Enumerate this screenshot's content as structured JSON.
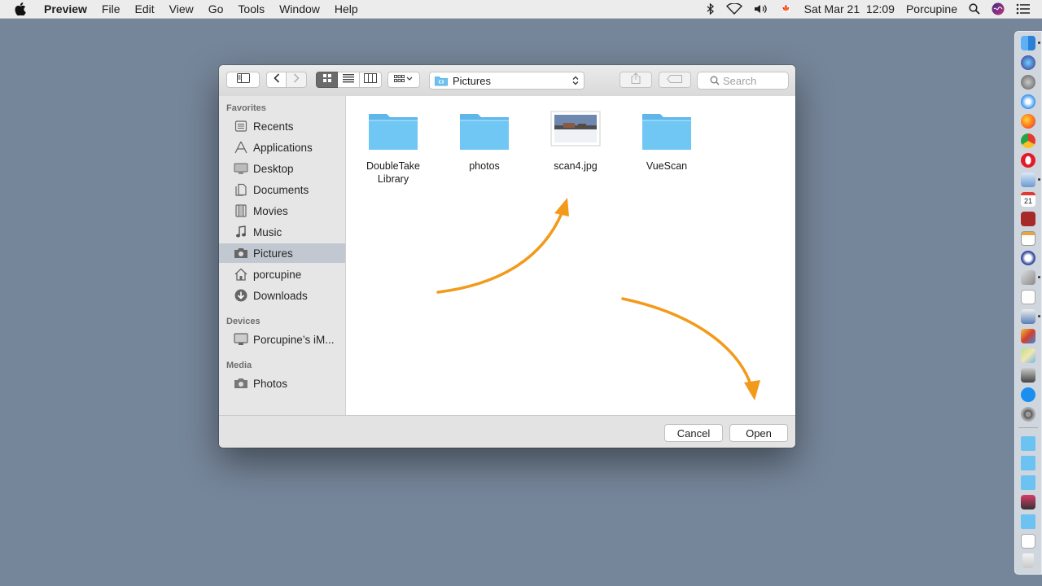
{
  "menubar": {
    "apple_icon": "apple-icon",
    "app_name": "Preview",
    "menus": [
      "File",
      "Edit",
      "View",
      "Go",
      "Tools",
      "Window",
      "Help"
    ],
    "datetime": "Sat Mar 21  12:09",
    "user": "Porcupine",
    "flag_label": "🍁",
    "status_icons": [
      "bluetooth-icon",
      "wifi-icon",
      "volume-icon",
      "canada-flag-icon",
      "spotlight-icon",
      "siri-icon",
      "notification-list-icon"
    ]
  },
  "dialog": {
    "toolbar": {
      "path": "Pictures",
      "search_placeholder": "Search"
    },
    "sidebar": {
      "favorites_header": "Favorites",
      "favorites": [
        {
          "label": "Recents",
          "icon": "recents-icon"
        },
        {
          "label": "Applications",
          "icon": "applications-icon"
        },
        {
          "label": "Desktop",
          "icon": "desktop-icon"
        },
        {
          "label": "Documents",
          "icon": "documents-icon"
        },
        {
          "label": "Movies",
          "icon": "movies-icon"
        },
        {
          "label": "Music",
          "icon": "music-icon"
        },
        {
          "label": "Pictures",
          "icon": "pictures-icon",
          "selected": true
        },
        {
          "label": "porcupine",
          "icon": "home-icon"
        },
        {
          "label": "Downloads",
          "icon": "downloads-icon"
        }
      ],
      "devices_header": "Devices",
      "devices": [
        {
          "label": "Porcupine’s iM...",
          "icon": "imac-icon"
        }
      ],
      "media_header": "Media",
      "media": [
        {
          "label": "Photos",
          "icon": "photos-camera-icon"
        }
      ]
    },
    "files": [
      {
        "name_line1": "DoubleTake",
        "name_line2": "Library",
        "type": "folder"
      },
      {
        "name_line1": "photos",
        "name_line2": "",
        "type": "folder"
      },
      {
        "name_line1": "scan4.jpg",
        "name_line2": "",
        "type": "image"
      },
      {
        "name_line1": "VueScan",
        "name_line2": "",
        "type": "folder"
      }
    ],
    "buttons": {
      "cancel": "Cancel",
      "open": "Open"
    }
  },
  "colors": {
    "desktop": "#76869a",
    "folder": "#6cc3f2",
    "arrow": "#f39a1a",
    "selection": "#c2c8d1"
  }
}
